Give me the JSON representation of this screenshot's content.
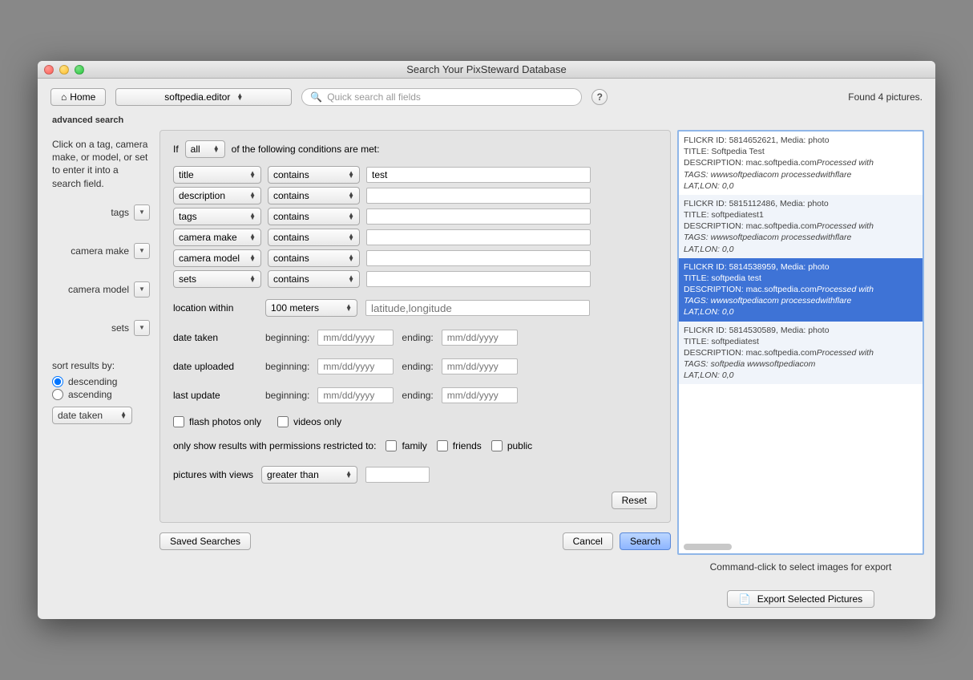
{
  "window_title": "Search Your PixSteward Database",
  "toolbar": {
    "home": "Home",
    "account": "softpedia.editor",
    "search_placeholder": "Quick search all fields",
    "found": "Found 4 pictures."
  },
  "section": "advanced search",
  "sidebar": {
    "hint": "Click on a tag, camera make, or model, or set to enter it into a search field.",
    "tags": "tags",
    "camera_make": "camera make",
    "camera_model": "camera model",
    "sets": "sets",
    "sort_label": "sort results by:",
    "descending": "descending",
    "ascending": "ascending",
    "sort_field": "date taken"
  },
  "form": {
    "if": "If",
    "all": "all",
    "of_cond": "of the following conditions are met:",
    "rows": [
      {
        "field": "title",
        "op": "contains",
        "value": "test"
      },
      {
        "field": "description",
        "op": "contains",
        "value": ""
      },
      {
        "field": "tags",
        "op": "contains",
        "value": ""
      },
      {
        "field": "camera make",
        "op": "contains",
        "value": ""
      },
      {
        "field": "camera model",
        "op": "contains",
        "value": ""
      },
      {
        "field": "sets",
        "op": "contains",
        "value": ""
      }
    ],
    "location_within": "location within",
    "distance": "100 meters",
    "latlon_ph": "latitude,longitude",
    "date_taken": "date taken",
    "date_uploaded": "date uploaded",
    "last_update": "last update",
    "beginning": "beginning:",
    "ending": "ending:",
    "date_ph": "mm/dd/yyyy",
    "flash_only": "flash photos only",
    "videos_only": "videos only",
    "perm_label": "only show results with permissions restricted to:",
    "family": "family",
    "friends": "friends",
    "public": "public",
    "views_label": "pictures with views",
    "views_op": "greater than",
    "reset": "Reset",
    "saved_searches": "Saved Searches",
    "cancel": "Cancel",
    "search": "Search"
  },
  "results": {
    "hint": "Command-click to select images for export",
    "export": "Export Selected Pictures",
    "items": [
      {
        "flickr_id": "5814652621",
        "media": "photo",
        "title": "Softpedia Test",
        "desc": "mac.softpedia.com<i>Processed with <a hr",
        "tags": "wwwsoftpediacom processedwithflare",
        "latlon": "0,0",
        "sel": false
      },
      {
        "flickr_id": "5815112486",
        "media": "photo",
        "title": "softpediatest1",
        "desc": "mac.softpedia.com<i>Processed with <a hr",
        "tags": "wwwsoftpediacom processedwithflare",
        "latlon": "0,0",
        "sel": false
      },
      {
        "flickr_id": "5814538959",
        "media": "photo",
        "title": "softpedia test",
        "desc": "mac.softpedia.com<i>Processed with <a hr",
        "tags": "wwwsoftpediacom processedwithflare",
        "latlon": "0,0",
        "sel": true
      },
      {
        "flickr_id": "5814530589",
        "media": "photo",
        "title": "softpediatest",
        "desc": "mac.softpedia.com<i>Processed with <a hr",
        "tags": "softpedia wwwsoftpediacom",
        "latlon": "0,0",
        "sel": false
      }
    ]
  }
}
